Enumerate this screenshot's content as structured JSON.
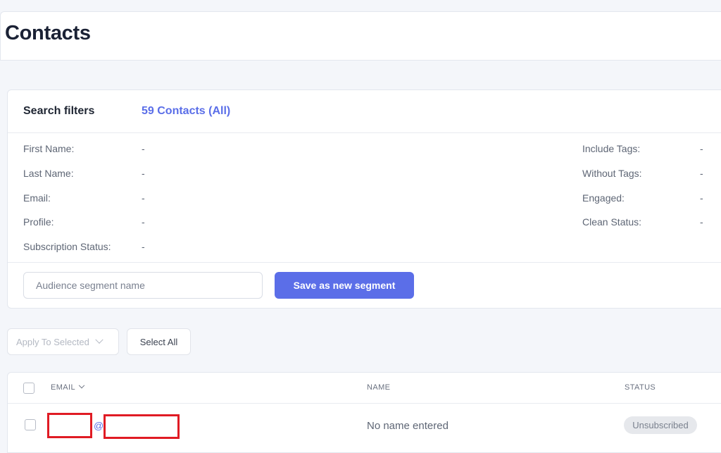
{
  "header": {
    "title": "Contacts"
  },
  "filters": {
    "title": "Search filters",
    "count_label": "59 Contacts (All)",
    "left": [
      {
        "label": "First Name:",
        "value": "-"
      },
      {
        "label": "Last Name:",
        "value": "-"
      },
      {
        "label": "Email:",
        "value": "-"
      },
      {
        "label": "Profile:",
        "value": "-"
      },
      {
        "label": "Subscription Status:",
        "value": "-"
      }
    ],
    "right": [
      {
        "label": "Include Tags:",
        "value": "-"
      },
      {
        "label": "Without Tags:",
        "value": "-"
      },
      {
        "label": "Engaged:",
        "value": "-"
      },
      {
        "label": "Clean Status:",
        "value": "-"
      }
    ],
    "segment_placeholder": "Audience segment name",
    "save_label": "Save as new segment"
  },
  "actions": {
    "apply_label": "Apply To Selected",
    "select_all_label": "Select All"
  },
  "table": {
    "columns": {
      "email": "EMAIL",
      "name": "NAME",
      "status": "STATUS"
    },
    "rows": [
      {
        "email_at": "@",
        "name": "No name entered",
        "status": "Unsubscribed"
      }
    ]
  },
  "colors": {
    "accent": "#5b6ee8",
    "redaction": "#e01b24"
  }
}
